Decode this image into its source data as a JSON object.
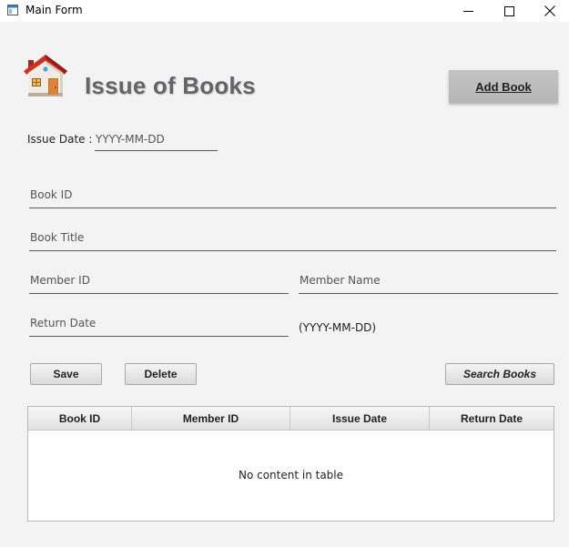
{
  "window": {
    "title": "Main Form"
  },
  "header": {
    "heading": "Issue of Books",
    "add_book_label": "Add Book"
  },
  "form": {
    "issue_date_label": "Issue Date :",
    "issue_date_placeholder": "YYYY-MM-DD",
    "book_id_placeholder": "Book ID",
    "book_title_placeholder": "Book Title",
    "member_id_placeholder": "Member ID",
    "member_name_placeholder": "Member Name",
    "return_date_placeholder": "Return Date",
    "return_date_hint": "(YYYY-MM-DD)"
  },
  "actions": {
    "save": "Save",
    "delete": "Delete",
    "search": "Search Books"
  },
  "table": {
    "columns": [
      "Book ID",
      "Member ID",
      "Issue Date",
      "Return Date"
    ],
    "empty_message": "No content in table"
  },
  "icons": {
    "app": "app-window-icon",
    "logo": "house-icon"
  }
}
